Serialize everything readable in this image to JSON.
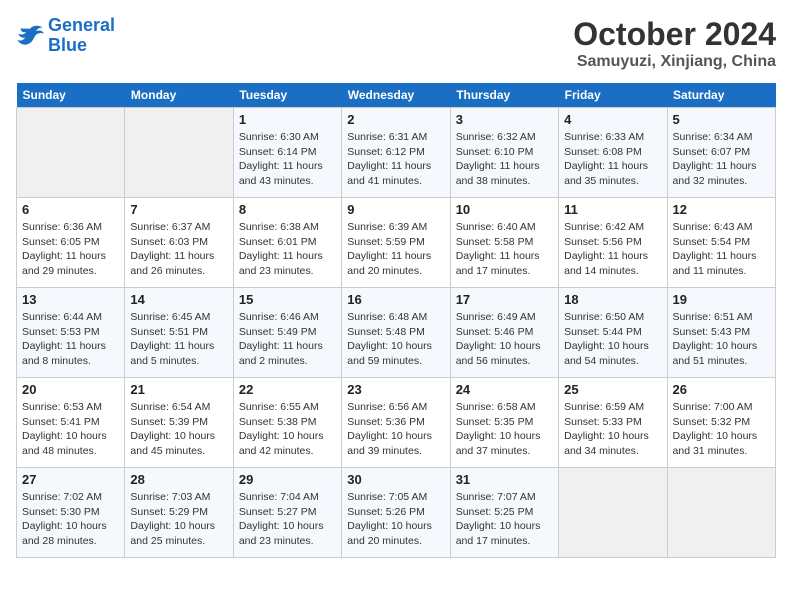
{
  "logo": {
    "line1": "General",
    "line2": "Blue"
  },
  "title": "October 2024",
  "location": "Samuyuzi, Xinjiang, China",
  "days_of_week": [
    "Sunday",
    "Monday",
    "Tuesday",
    "Wednesday",
    "Thursday",
    "Friday",
    "Saturday"
  ],
  "weeks": [
    [
      {
        "day": "",
        "sunrise": "",
        "sunset": "",
        "daylight": ""
      },
      {
        "day": "",
        "sunrise": "",
        "sunset": "",
        "daylight": ""
      },
      {
        "day": "1",
        "sunrise": "Sunrise: 6:30 AM",
        "sunset": "Sunset: 6:14 PM",
        "daylight": "Daylight: 11 hours and 43 minutes."
      },
      {
        "day": "2",
        "sunrise": "Sunrise: 6:31 AM",
        "sunset": "Sunset: 6:12 PM",
        "daylight": "Daylight: 11 hours and 41 minutes."
      },
      {
        "day": "3",
        "sunrise": "Sunrise: 6:32 AM",
        "sunset": "Sunset: 6:10 PM",
        "daylight": "Daylight: 11 hours and 38 minutes."
      },
      {
        "day": "4",
        "sunrise": "Sunrise: 6:33 AM",
        "sunset": "Sunset: 6:08 PM",
        "daylight": "Daylight: 11 hours and 35 minutes."
      },
      {
        "day": "5",
        "sunrise": "Sunrise: 6:34 AM",
        "sunset": "Sunset: 6:07 PM",
        "daylight": "Daylight: 11 hours and 32 minutes."
      }
    ],
    [
      {
        "day": "6",
        "sunrise": "Sunrise: 6:36 AM",
        "sunset": "Sunset: 6:05 PM",
        "daylight": "Daylight: 11 hours and 29 minutes."
      },
      {
        "day": "7",
        "sunrise": "Sunrise: 6:37 AM",
        "sunset": "Sunset: 6:03 PM",
        "daylight": "Daylight: 11 hours and 26 minutes."
      },
      {
        "day": "8",
        "sunrise": "Sunrise: 6:38 AM",
        "sunset": "Sunset: 6:01 PM",
        "daylight": "Daylight: 11 hours and 23 minutes."
      },
      {
        "day": "9",
        "sunrise": "Sunrise: 6:39 AM",
        "sunset": "Sunset: 5:59 PM",
        "daylight": "Daylight: 11 hours and 20 minutes."
      },
      {
        "day": "10",
        "sunrise": "Sunrise: 6:40 AM",
        "sunset": "Sunset: 5:58 PM",
        "daylight": "Daylight: 11 hours and 17 minutes."
      },
      {
        "day": "11",
        "sunrise": "Sunrise: 6:42 AM",
        "sunset": "Sunset: 5:56 PM",
        "daylight": "Daylight: 11 hours and 14 minutes."
      },
      {
        "day": "12",
        "sunrise": "Sunrise: 6:43 AM",
        "sunset": "Sunset: 5:54 PM",
        "daylight": "Daylight: 11 hours and 11 minutes."
      }
    ],
    [
      {
        "day": "13",
        "sunrise": "Sunrise: 6:44 AM",
        "sunset": "Sunset: 5:53 PM",
        "daylight": "Daylight: 11 hours and 8 minutes."
      },
      {
        "day": "14",
        "sunrise": "Sunrise: 6:45 AM",
        "sunset": "Sunset: 5:51 PM",
        "daylight": "Daylight: 11 hours and 5 minutes."
      },
      {
        "day": "15",
        "sunrise": "Sunrise: 6:46 AM",
        "sunset": "Sunset: 5:49 PM",
        "daylight": "Daylight: 11 hours and 2 minutes."
      },
      {
        "day": "16",
        "sunrise": "Sunrise: 6:48 AM",
        "sunset": "Sunset: 5:48 PM",
        "daylight": "Daylight: 10 hours and 59 minutes."
      },
      {
        "day": "17",
        "sunrise": "Sunrise: 6:49 AM",
        "sunset": "Sunset: 5:46 PM",
        "daylight": "Daylight: 10 hours and 56 minutes."
      },
      {
        "day": "18",
        "sunrise": "Sunrise: 6:50 AM",
        "sunset": "Sunset: 5:44 PM",
        "daylight": "Daylight: 10 hours and 54 minutes."
      },
      {
        "day": "19",
        "sunrise": "Sunrise: 6:51 AM",
        "sunset": "Sunset: 5:43 PM",
        "daylight": "Daylight: 10 hours and 51 minutes."
      }
    ],
    [
      {
        "day": "20",
        "sunrise": "Sunrise: 6:53 AM",
        "sunset": "Sunset: 5:41 PM",
        "daylight": "Daylight: 10 hours and 48 minutes."
      },
      {
        "day": "21",
        "sunrise": "Sunrise: 6:54 AM",
        "sunset": "Sunset: 5:39 PM",
        "daylight": "Daylight: 10 hours and 45 minutes."
      },
      {
        "day": "22",
        "sunrise": "Sunrise: 6:55 AM",
        "sunset": "Sunset: 5:38 PM",
        "daylight": "Daylight: 10 hours and 42 minutes."
      },
      {
        "day": "23",
        "sunrise": "Sunrise: 6:56 AM",
        "sunset": "Sunset: 5:36 PM",
        "daylight": "Daylight: 10 hours and 39 minutes."
      },
      {
        "day": "24",
        "sunrise": "Sunrise: 6:58 AM",
        "sunset": "Sunset: 5:35 PM",
        "daylight": "Daylight: 10 hours and 37 minutes."
      },
      {
        "day": "25",
        "sunrise": "Sunrise: 6:59 AM",
        "sunset": "Sunset: 5:33 PM",
        "daylight": "Daylight: 10 hours and 34 minutes."
      },
      {
        "day": "26",
        "sunrise": "Sunrise: 7:00 AM",
        "sunset": "Sunset: 5:32 PM",
        "daylight": "Daylight: 10 hours and 31 minutes."
      }
    ],
    [
      {
        "day": "27",
        "sunrise": "Sunrise: 7:02 AM",
        "sunset": "Sunset: 5:30 PM",
        "daylight": "Daylight: 10 hours and 28 minutes."
      },
      {
        "day": "28",
        "sunrise": "Sunrise: 7:03 AM",
        "sunset": "Sunset: 5:29 PM",
        "daylight": "Daylight: 10 hours and 25 minutes."
      },
      {
        "day": "29",
        "sunrise": "Sunrise: 7:04 AM",
        "sunset": "Sunset: 5:27 PM",
        "daylight": "Daylight: 10 hours and 23 minutes."
      },
      {
        "day": "30",
        "sunrise": "Sunrise: 7:05 AM",
        "sunset": "Sunset: 5:26 PM",
        "daylight": "Daylight: 10 hours and 20 minutes."
      },
      {
        "day": "31",
        "sunrise": "Sunrise: 7:07 AM",
        "sunset": "Sunset: 5:25 PM",
        "daylight": "Daylight: 10 hours and 17 minutes."
      },
      {
        "day": "",
        "sunrise": "",
        "sunset": "",
        "daylight": ""
      },
      {
        "day": "",
        "sunrise": "",
        "sunset": "",
        "daylight": ""
      }
    ]
  ]
}
